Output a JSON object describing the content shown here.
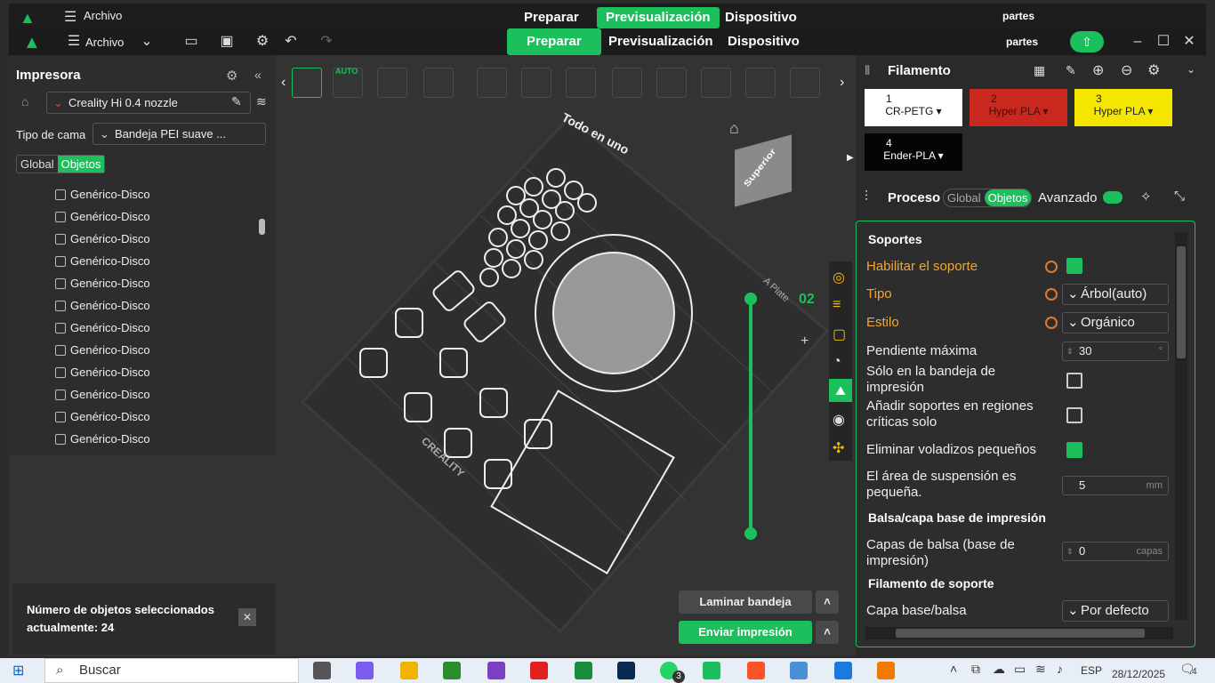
{
  "ghost_bar": {
    "file_menu": "Archivo",
    "tabs": [
      "Preparar",
      "Previsualización",
      "Dispositivo"
    ],
    "user": "partes"
  },
  "titlebar": {
    "file_menu": "Archivo",
    "tabs": [
      {
        "label": "Preparar",
        "active": true
      },
      {
        "label": "Previsualización",
        "active": false
      },
      {
        "label": "Dispositivo",
        "active": false
      }
    ],
    "user": "partes"
  },
  "left_panel": {
    "title": "Impresora",
    "printer": "Creality Hi 0.4 nozzle",
    "bed_label": "Tipo de cama",
    "bed_value": "Bandeja PEI suave ...",
    "scope_tabs": [
      {
        "label": "Global",
        "active": false
      },
      {
        "label": "Objetos",
        "active": true
      }
    ],
    "objects": [
      "Genérico-Disco",
      "Genérico-Disco",
      "Genérico-Disco",
      "Genérico-Disco",
      "Genérico-Disco",
      "Genérico-Disco",
      "Genérico-Disco",
      "Genérico-Disco",
      "Genérico-Disco",
      "Genérico-Disco",
      "Genérico-Disco",
      "Genérico-Disco"
    ]
  },
  "notification": {
    "text": "Número de objetos seleccionados actualmente: 24"
  },
  "viewport": {
    "toolbar_badge": "AUTO",
    "view_cube": "Superior",
    "plate_text": "Todo en uno",
    "plate_brand": "CREALITY",
    "plate_number": "02",
    "plate_tag": "A Plate"
  },
  "actions": {
    "slice": "Laminar bandeja",
    "send": "Enviar impresión"
  },
  "right_panel": {
    "filament_title": "Filamento",
    "filaments": [
      {
        "num": "1",
        "name": "CR-PETG",
        "color": "#ffffff",
        "text": "#111111"
      },
      {
        "num": "2",
        "name": "Hyper PLA",
        "color": "#c8281e",
        "text": "#4a0a0a"
      },
      {
        "num": "3",
        "name": "Hyper PLA",
        "color": "#f5e600",
        "text": "#222222"
      },
      {
        "num": "4",
        "name": "Ender-PLA",
        "color": "#050505",
        "text": "#ffffff"
      }
    ],
    "process_title": "Proceso",
    "process_tabs": [
      "Global",
      "Objetos"
    ],
    "advanced": "Avanzado",
    "sections": {
      "supports": "Soportes",
      "raft": "Balsa/capa base de impresión",
      "support_filament": "Filamento de soporte"
    },
    "rows": {
      "enable_support": "Habilitar el soporte",
      "type": "Tipo",
      "type_value": "Árbol(auto)",
      "style": "Estilo",
      "style_value": "Orgánico",
      "max_slope": "Pendiente máxima",
      "max_slope_value": "30",
      "only_on_bed": "Sólo en la bandeja de impresión",
      "critical_only": "Añadir soportes en regiones críticas solo",
      "remove_small": "Eliminar voladizos pequeños",
      "small_area": "El área de suspensión es pequeña.",
      "small_area_value": "5",
      "small_area_unit": "mm",
      "raft_layers": "Capas de balsa (base de impresión)",
      "raft_layers_value": "0",
      "raft_layers_unit": "capas",
      "base_layer": "Capa base/balsa",
      "base_layer_value": "Por defecto"
    }
  },
  "taskbar": {
    "search": "Buscar",
    "badge": "3",
    "lang": "ESP",
    "date": "28/12/2025",
    "notif_count": "4"
  }
}
